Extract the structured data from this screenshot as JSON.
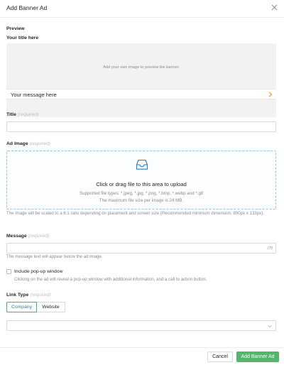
{
  "dialog": {
    "title": "Add Banner Ad"
  },
  "preview": {
    "section_label": "Preview",
    "banner_title": "Your title here",
    "image_hint": "Add your own image to preview the banner.",
    "message": "Your message here",
    "chevron_icon": "chevron-right-icon",
    "accent_color": "#f5a623"
  },
  "title_field": {
    "label": "Title",
    "required": "(required)",
    "value": ""
  },
  "ad_image": {
    "label": "Ad Image",
    "required": "(required)",
    "upload_icon": "inbox-icon",
    "upload_title": "Click or drag file to this area to upload",
    "file_types": "Supported file types: *.jpeg, *.jpg, *.png, *.bmp, *.webp and *.gif",
    "max_size": "The maximum file size per image is 24 MB.",
    "help": "The image will be scaled to a 6:1 ratio depending on placement and screen size (Recommended minimum dimension: 800px x 133px)."
  },
  "message_field": {
    "label": "Message",
    "required": "(required)",
    "value": "",
    "counter": "/70",
    "help": "The message text will appear below the ad image."
  },
  "popup": {
    "checked": false,
    "label": "Include pop-up window",
    "help": "Clicking on the ad will reveal a pop-up window with additional information, and a call to action button."
  },
  "link_type": {
    "label": "Link Type",
    "required": "(required)",
    "options": [
      "Company",
      "Website"
    ],
    "selected": "Company",
    "select_value": ""
  },
  "footer": {
    "cancel_label": "Cancel",
    "submit_label": "Add Banner Ad"
  },
  "colors": {
    "primary_green": "#52b66b",
    "selected_blue": "#1f7fd1",
    "upload_border": "#91c2e8"
  }
}
